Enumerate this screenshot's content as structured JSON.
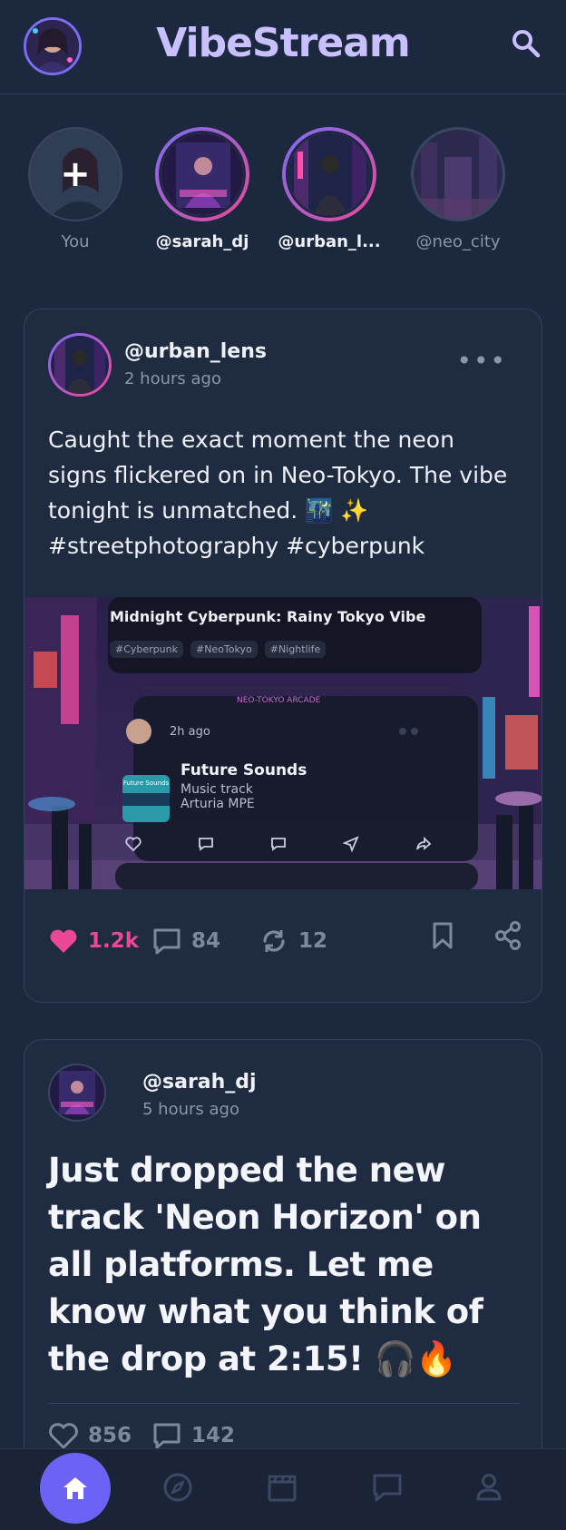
{
  "header": {
    "title": "VibeStream",
    "profile_avatar": "user-avatar",
    "search_icon": "search-icon"
  },
  "stories": [
    {
      "label": "You",
      "type": "add",
      "icon": "plus-icon"
    },
    {
      "label": "@sarah_dj",
      "type": "active"
    },
    {
      "label": "@urban_l...",
      "type": "active"
    },
    {
      "label": "@neo_city",
      "type": "seen"
    }
  ],
  "posts": [
    {
      "username": "@urban_lens",
      "time": "2 hours ago",
      "text": "Caught the exact moment the neon signs flickered on in Neo-Tokyo. The vibe tonight is unmatched. 🌃 ✨ #streetphotography #cyberpunk",
      "image": {
        "title": "Midnight Cyberpunk: Rainy Tokyo Vibe",
        "tags": [
          "#Cyberpunk",
          "#NeoTokyo",
          "#Nightlife"
        ],
        "arcade_sign": "NEO-TOKYO ARCADE",
        "inner_time": "2h ago",
        "track_title": "Future Sounds",
        "track_sub1": "Music track",
        "track_sub2": "Arturia MPE",
        "thumb_label": "Future Sounds"
      },
      "likes": "1.2k",
      "comments": "84",
      "reposts": "12",
      "liked": true
    },
    {
      "username": "@sarah_dj",
      "time": "5 hours ago",
      "text": "Just dropped the new track 'Neon Horizon' on all platforms. Let me know what you think of the drop at 2:15! 🎧🔥",
      "likes": "856",
      "comments": "142",
      "liked": false
    }
  ],
  "nav": {
    "items": [
      "home-icon",
      "compass-icon",
      "clapperboard-icon",
      "chat-icon",
      "profile-icon"
    ],
    "active": "home-icon"
  },
  "colors": {
    "background": "#1c283d",
    "accent": "#6c63f5",
    "title": "#c8c0ff",
    "like": "#ec4899"
  }
}
